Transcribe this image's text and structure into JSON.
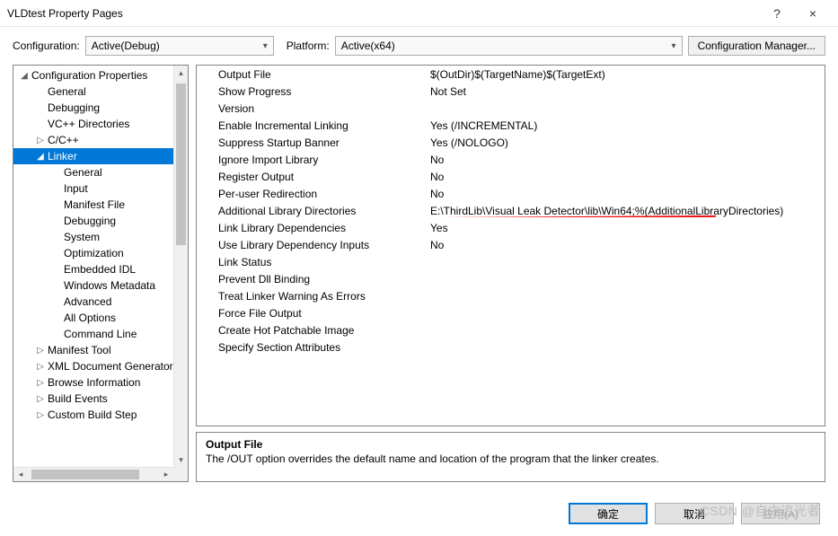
{
  "titlebar": {
    "title": "VLDtest Property Pages",
    "help": "?",
    "close": "×"
  },
  "config": {
    "cfg_label": "Configuration:",
    "cfg_value": "Active(Debug)",
    "plat_label": "Platform:",
    "plat_value": "Active(x64)",
    "mgr_label": "Configuration Manager..."
  },
  "tree": [
    {
      "d": 0,
      "caret": "◢",
      "label": "Configuration Properties"
    },
    {
      "d": 1,
      "caret": "",
      "label": "General"
    },
    {
      "d": 1,
      "caret": "",
      "label": "Debugging"
    },
    {
      "d": 1,
      "caret": "",
      "label": "VC++ Directories"
    },
    {
      "d": 1,
      "caret": "▷",
      "label": "C/C++"
    },
    {
      "d": 1,
      "caret": "◢",
      "label": "Linker",
      "selected": true
    },
    {
      "d": 2,
      "caret": "",
      "label": "General"
    },
    {
      "d": 2,
      "caret": "",
      "label": "Input"
    },
    {
      "d": 2,
      "caret": "",
      "label": "Manifest File"
    },
    {
      "d": 2,
      "caret": "",
      "label": "Debugging"
    },
    {
      "d": 2,
      "caret": "",
      "label": "System"
    },
    {
      "d": 2,
      "caret": "",
      "label": "Optimization"
    },
    {
      "d": 2,
      "caret": "",
      "label": "Embedded IDL"
    },
    {
      "d": 2,
      "caret": "",
      "label": "Windows Metadata"
    },
    {
      "d": 2,
      "caret": "",
      "label": "Advanced"
    },
    {
      "d": 2,
      "caret": "",
      "label": "All Options"
    },
    {
      "d": 2,
      "caret": "",
      "label": "Command Line"
    },
    {
      "d": 1,
      "caret": "▷",
      "label": "Manifest Tool"
    },
    {
      "d": 1,
      "caret": "▷",
      "label": "XML Document Generator"
    },
    {
      "d": 1,
      "caret": "▷",
      "label": "Browse Information"
    },
    {
      "d": 1,
      "caret": "▷",
      "label": "Build Events"
    },
    {
      "d": 1,
      "caret": "▷",
      "label": "Custom Build Step"
    }
  ],
  "grid": [
    {
      "k": "Output File",
      "v": "$(OutDir)$(TargetName)$(TargetExt)"
    },
    {
      "k": "Show Progress",
      "v": "Not Set"
    },
    {
      "k": "Version",
      "v": ""
    },
    {
      "k": "Enable Incremental Linking",
      "v": "Yes (/INCREMENTAL)"
    },
    {
      "k": "Suppress Startup Banner",
      "v": "Yes (/NOLOGO)"
    },
    {
      "k": "Ignore Import Library",
      "v": "No"
    },
    {
      "k": "Register Output",
      "v": "No"
    },
    {
      "k": "Per-user Redirection",
      "v": "No"
    },
    {
      "k": "Additional Library Directories",
      "v": "E:\\ThirdLib\\Visual Leak Detector\\lib\\Win64;%(AdditionalLibraryDirectories)",
      "hl": true
    },
    {
      "k": "Link Library Dependencies",
      "v": "Yes"
    },
    {
      "k": "Use Library Dependency Inputs",
      "v": "No"
    },
    {
      "k": "Link Status",
      "v": ""
    },
    {
      "k": "Prevent Dll Binding",
      "v": ""
    },
    {
      "k": "Treat Linker Warning As Errors",
      "v": ""
    },
    {
      "k": "Force File Output",
      "v": ""
    },
    {
      "k": "Create Hot Patchable Image",
      "v": ""
    },
    {
      "k": "Specify Section Attributes",
      "v": ""
    }
  ],
  "desc": {
    "title": "Output File",
    "text": "The /OUT option overrides the default name and location of the program that the linker creates."
  },
  "footer": {
    "ok": "确定",
    "cancel": "取消",
    "apply": "应用(A)"
  },
  "watermark": "CSDN @自由追光者"
}
